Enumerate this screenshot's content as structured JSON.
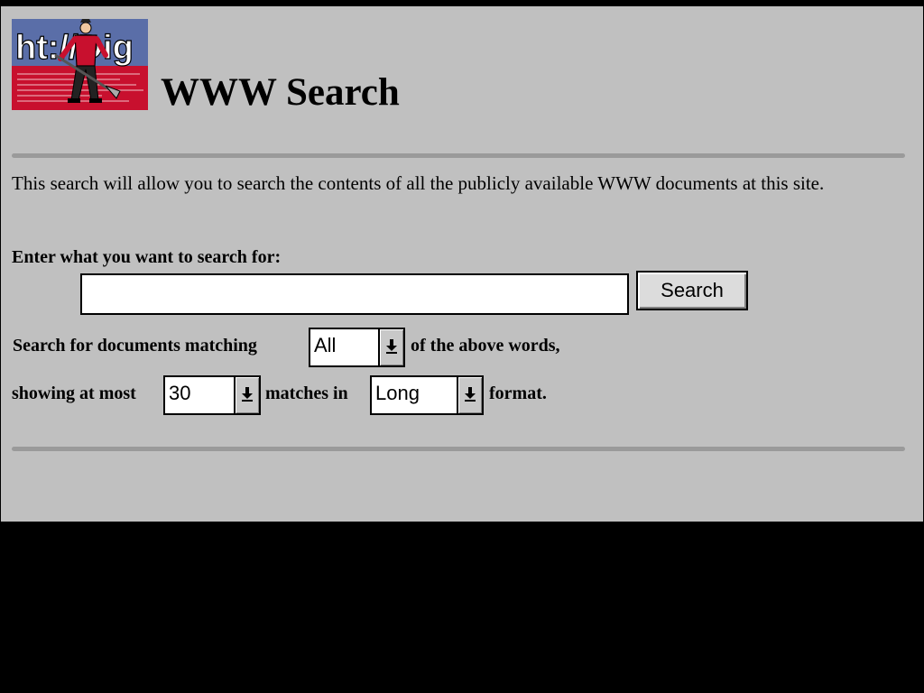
{
  "logo": {
    "text": "ht://Dig",
    "alt": "ht://Dig"
  },
  "page": {
    "title": "WWW Search",
    "intro": "This search will allow you to search the contents of all the publicly available WWW documents at this site.",
    "prompt": "Enter what you want to search for:"
  },
  "search": {
    "value": "",
    "button_label": "Search"
  },
  "options": {
    "match_prefix": "Search for documents matching",
    "match_value": "All",
    "match_suffix": "of the above words,",
    "showing_prefix": "showing at most",
    "count_value": "30",
    "matches_in": "matches in",
    "format_value": "Long",
    "format_suffix": "format."
  },
  "colors": {
    "page_bg": "#c0c0c0",
    "frame_bg": "#000000",
    "rule": "#9a9a9a",
    "logo_blue": "#5a6ea8",
    "logo_red": "#c8102e"
  }
}
